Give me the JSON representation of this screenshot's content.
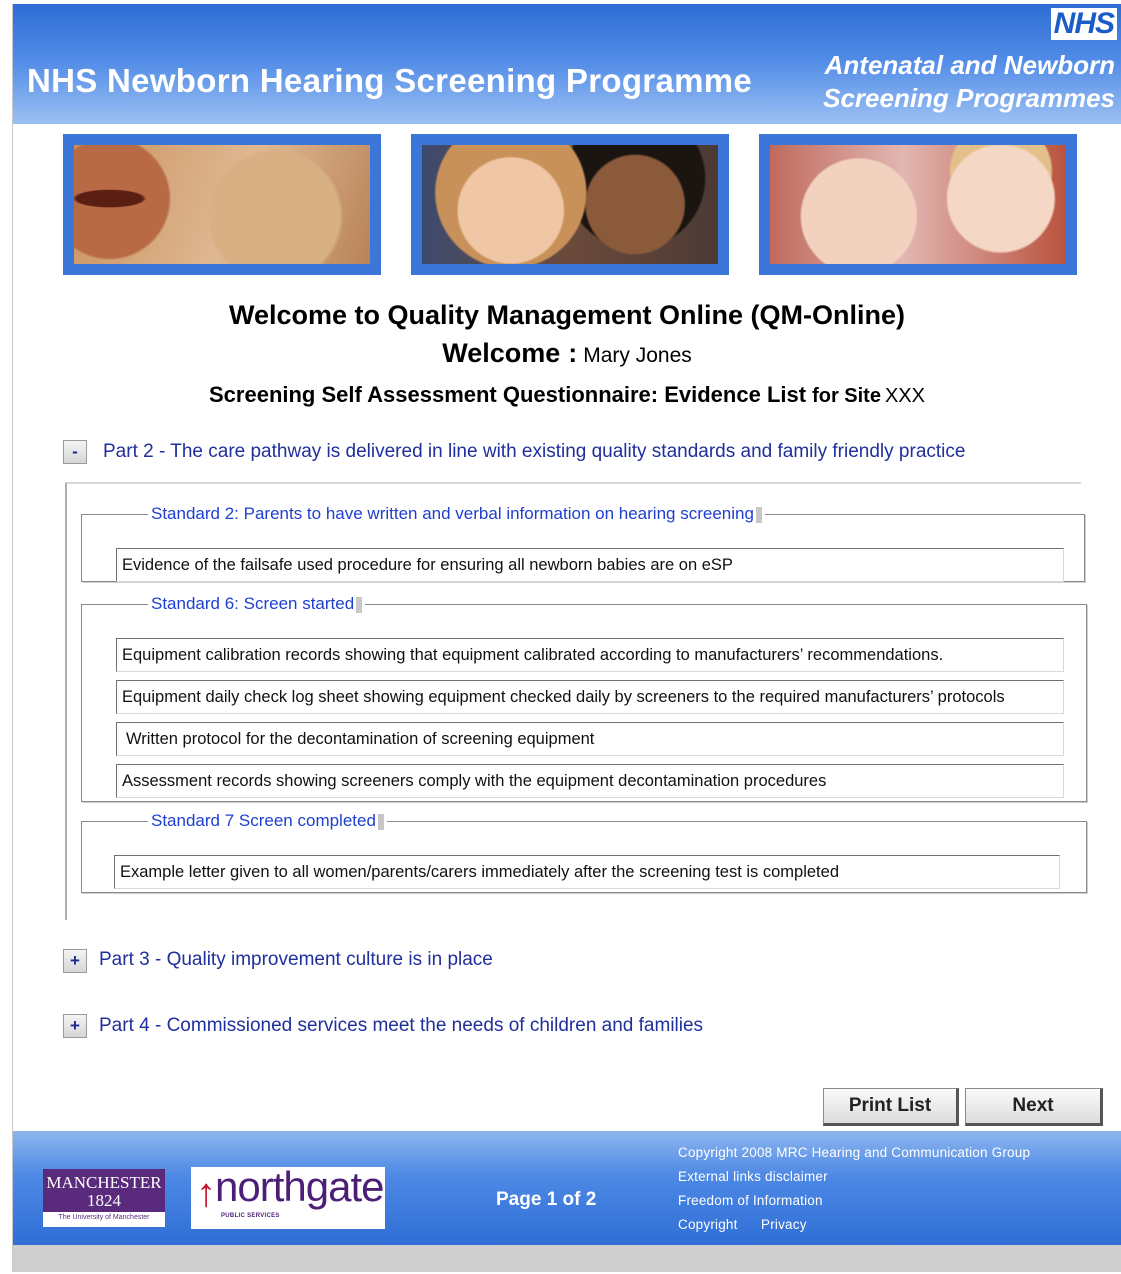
{
  "header": {
    "site_title": "NHS Newborn Hearing Screening Programme",
    "nhs_logo": "NHS",
    "programme_line1": "Antenatal and Newborn",
    "programme_line2": "Screening Programmes",
    "brand_color": "#3a78dc"
  },
  "welcome": {
    "title": "Welcome to Quality Management Online (QM-Online)",
    "label": "Welcome",
    "colon": ":",
    "user_name": "Mary Jones",
    "questionnaire_title": "Screening Self Assessment Questionnaire: Evidence List",
    "site_label": "for Site",
    "site_value": "XXX"
  },
  "parts": [
    {
      "toggle": "-",
      "label": "Part 2 - The care pathway is delivered in line with existing quality standards and family friendly practice",
      "expanded": true,
      "standards": [
        {
          "title": "Standard 2: Parents to have written and verbal information on hearing screening",
          "evidence": [
            "Evidence of the failsafe used procedure for ensuring all newborn babies are on eSP"
          ]
        },
        {
          "title": "Standard 6: Screen started",
          "evidence": [
            "Equipment calibration records showing that equipment calibrated according to manufacturers’ recommendations.",
            "Equipment daily check log sheet showing equipment checked daily by screeners to the required manufacturers’ protocols",
            "Written protocol for the decontamination of screening equipment",
            "Assessment records showing screeners comply with the equipment decontamination procedures"
          ]
        },
        {
          "title": "Standard 7 Screen completed",
          "evidence": [
            "Example letter given to all women/parents/carers immediately after the screening test is completed"
          ]
        }
      ]
    },
    {
      "toggle": "+",
      "label": "Part 3 - Quality improvement culture is in place",
      "expanded": false
    },
    {
      "toggle": "+",
      "label": "Part 4 - Commissioned services meet the needs of children and families",
      "expanded": false
    }
  ],
  "actions": {
    "print_list": "Print List",
    "next": "Next"
  },
  "footer": {
    "manchester_logo": "MANCHESTER 1824",
    "manchester_subtitle": "The University of Manchester",
    "northgate_logo": "northgate",
    "northgate_subtitle": "PUBLIC SERVICES",
    "page_indicator": "Page 1 of 2",
    "copyright_notice": "Copyright 2008 MRC Hearing and Communication Group",
    "external_links_disclaimer": "External links disclaimer",
    "freedom_of_information": "Freedom of Information",
    "copyright": "Copyright",
    "privacy": "Privacy"
  }
}
